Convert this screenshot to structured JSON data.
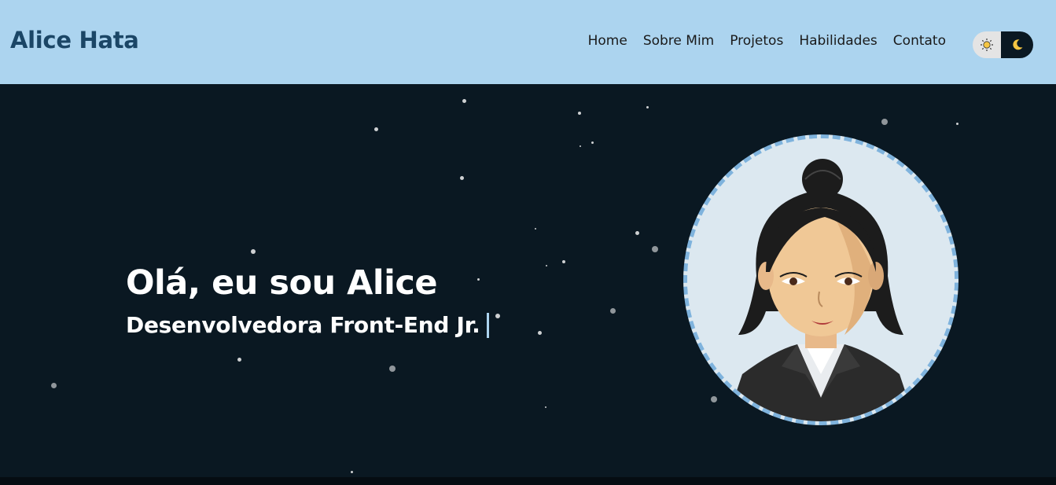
{
  "header": {
    "brand": "Alice Hata",
    "nav": [
      "Home",
      "Sobre Mim",
      "Projetos",
      "Habilidades",
      "Contato"
    ],
    "theme_toggle": {
      "light_icon": "sun-icon",
      "dark_icon": "moon-icon",
      "active": "dark"
    }
  },
  "hero": {
    "title": "Olá, eu sou Alice",
    "subtitle": "Desenvolvedora Front-End Jr.",
    "avatar": "cartoon-avatar-illustration"
  },
  "colors": {
    "header_bg": "#acd4ef",
    "brand": "#1b4666",
    "hero_bg": "#0a1822",
    "accent": "#7fb3dd",
    "text_light": "#ffffff"
  }
}
